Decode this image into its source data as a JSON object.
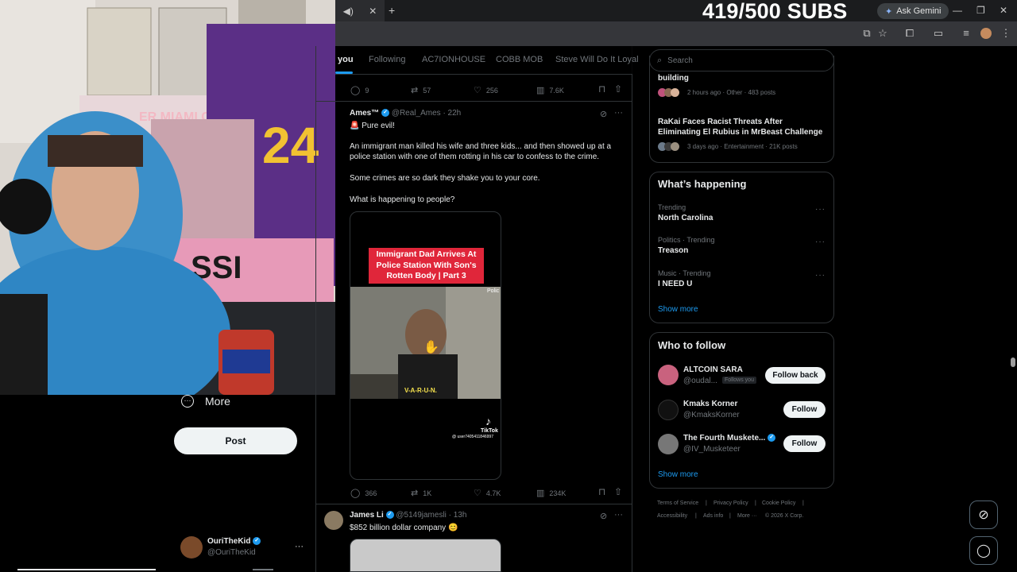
{
  "overlay": {
    "subs_counter": "419/500 SUBS"
  },
  "browser": {
    "tab_close": "✕",
    "new_tab": "+",
    "ask_gemini": "Ask Gemini"
  },
  "left_nav": {
    "more_label": "More",
    "post_button": "Post",
    "account": {
      "name": "OuriTheKid",
      "handle": "@OuriTheKid"
    }
  },
  "feed_tabs": [
    "you",
    "Following",
    "AC7IONHOUSE",
    "COBB MOB",
    "Steve Will Do It Loyal"
  ],
  "tweet_top_actions": {
    "replies": "9",
    "reposts": "57",
    "likes": "256",
    "views": "7.6K"
  },
  "tweet_main": {
    "name": "Ames™",
    "handle": "@Real_Ames",
    "time": "· 22h",
    "line1": "🚨 Pure evil!",
    "para1": "An immigrant  man killed his wife and three kids... and then showed up at a police station with one of them rotting  in his car to confess to the crime.",
    "para2": "Some crimes are so dark they shake you to your core.",
    "para3": "What is happening to people?",
    "video_caption": "Immigrant Dad Arrives At Police Station With Son's Rotten Body | Part 3",
    "video_subtitle": "V-A-R-U-N.",
    "video_brand": "TikTok",
    "video_user": "@ user7405411846997",
    "video_corner": "Polic",
    "actions": {
      "replies": "366",
      "reposts": "1K",
      "likes": "4.7K",
      "views": "234K"
    }
  },
  "tweet_second": {
    "name": "James Li",
    "handle": "@5149jamesli",
    "time": "· 13h",
    "text": "$852 billion dollar company 😊"
  },
  "search": {
    "placeholder": "Search"
  },
  "top_card": {
    "item1_title": "building",
    "item1_meta": "2 hours ago · Other · 483 posts",
    "item2_title": "RaKai Faces Racist Threats After Eliminating El Rubius in MrBeast Challenge",
    "item2_meta": "3 days ago · Entertainment · 21K posts"
  },
  "whats_happening": {
    "title": "What’s happening",
    "trends": [
      {
        "meta": "Trending",
        "name": "North Carolina"
      },
      {
        "meta": "Politics · Trending",
        "name": "Treason"
      },
      {
        "meta": "Music · Trending",
        "name": "I NEED U"
      }
    ],
    "show_more": "Show more"
  },
  "who_to_follow": {
    "title": "Who to follow",
    "accounts": [
      {
        "name": "ALTCOIN SARA",
        "handle": "@oudal...",
        "badge": "Follows you",
        "button": "Follow back"
      },
      {
        "name": "Kmaks Korner",
        "handle": "@KmaksKorner",
        "button": "Follow"
      },
      {
        "name": "The Fourth Muskete...",
        "handle": "@IV_Musketeer",
        "button": "Follow"
      }
    ],
    "show_more": "Show more"
  },
  "footer": {
    "links": [
      "Terms of Service",
      "Privacy Policy",
      "Cookie Policy",
      "Accessibility",
      "Ads info",
      "More ···",
      "© 2026 X Corp."
    ]
  },
  "colors": {
    "accent": "#1d9bf0",
    "background": "#000000",
    "border": "#2f3336",
    "muted": "#71767b",
    "caption_red": "#e0263a"
  }
}
